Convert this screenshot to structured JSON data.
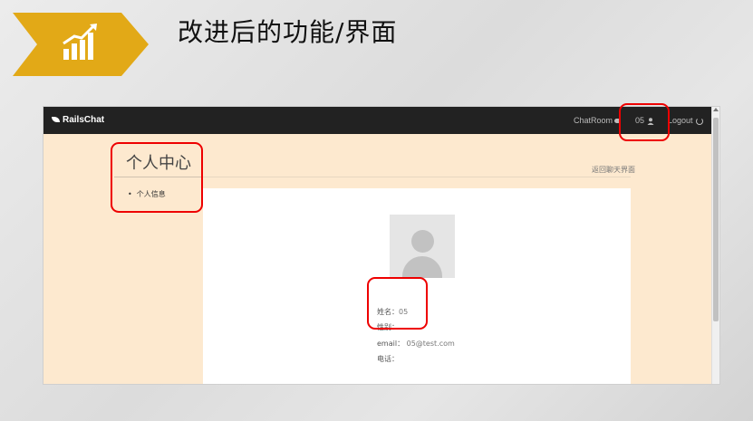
{
  "slide": {
    "title": "改进后的功能/界面",
    "badge_icon": "growth-chart-icon",
    "badge_color": "#e2a917"
  },
  "app": {
    "brand": "RailsChat",
    "nav": {
      "chatroom": "ChatRoom",
      "user": "05",
      "logout": "Logout"
    },
    "sidebar": {
      "title": "个人中心",
      "items": [
        "个人信息"
      ]
    },
    "back_link": "返回聊天界面",
    "profile": {
      "name_label": "姓名：",
      "name_value": "05",
      "gender_label": "性别：",
      "gender_value": "",
      "email_label": "email：",
      "email_value": "05@test.com",
      "phone_label": "电话：",
      "phone_value": ""
    },
    "colors": {
      "navbar": "#222222",
      "page_background": "#fde9cf",
      "highlight": "#ee0000"
    }
  }
}
